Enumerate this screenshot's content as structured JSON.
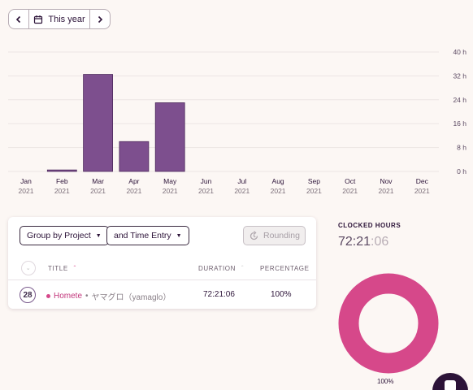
{
  "date_range": {
    "label": "This year"
  },
  "chart_data": {
    "type": "bar",
    "categories": [
      "Jan",
      "Feb",
      "Mar",
      "Apr",
      "May",
      "Jun",
      "Jul",
      "Aug",
      "Sep",
      "Oct",
      "Nov",
      "Dec"
    ],
    "category_sub": [
      "2021",
      "2021",
      "2021",
      "2021",
      "2021",
      "2021",
      "2021",
      "2021",
      "2021",
      "2021",
      "2021",
      "2021"
    ],
    "values": [
      0,
      0.5,
      32.5,
      10,
      23,
      0,
      0,
      0,
      0,
      0,
      0,
      0
    ],
    "yticks": [
      "40 h",
      "32 h",
      "24 h",
      "16 h",
      "8 h",
      "0 h"
    ],
    "ylim": [
      0,
      40
    ],
    "grid": true,
    "bar_color": "#7d4f8e"
  },
  "toolbar": {
    "group_by": "Group by Project",
    "sub_group": "and Time Entry",
    "rounding": "Rounding"
  },
  "table": {
    "columns": {
      "title": "TITLE",
      "duration": "DURATION",
      "percentage": "PERCENTAGE"
    },
    "rows": [
      {
        "count": "28",
        "project": "Homete",
        "client": "ヤマグロ（yamaglo）",
        "duration": "72:21:06",
        "percentage": "100%",
        "color": "#d6488a"
      }
    ]
  },
  "summary": {
    "label": "CLOCKED HOURS",
    "hours_main": "72:21",
    "hours_sec": ":06",
    "donut_pct": "100%",
    "donut_color": "#d6488a"
  }
}
